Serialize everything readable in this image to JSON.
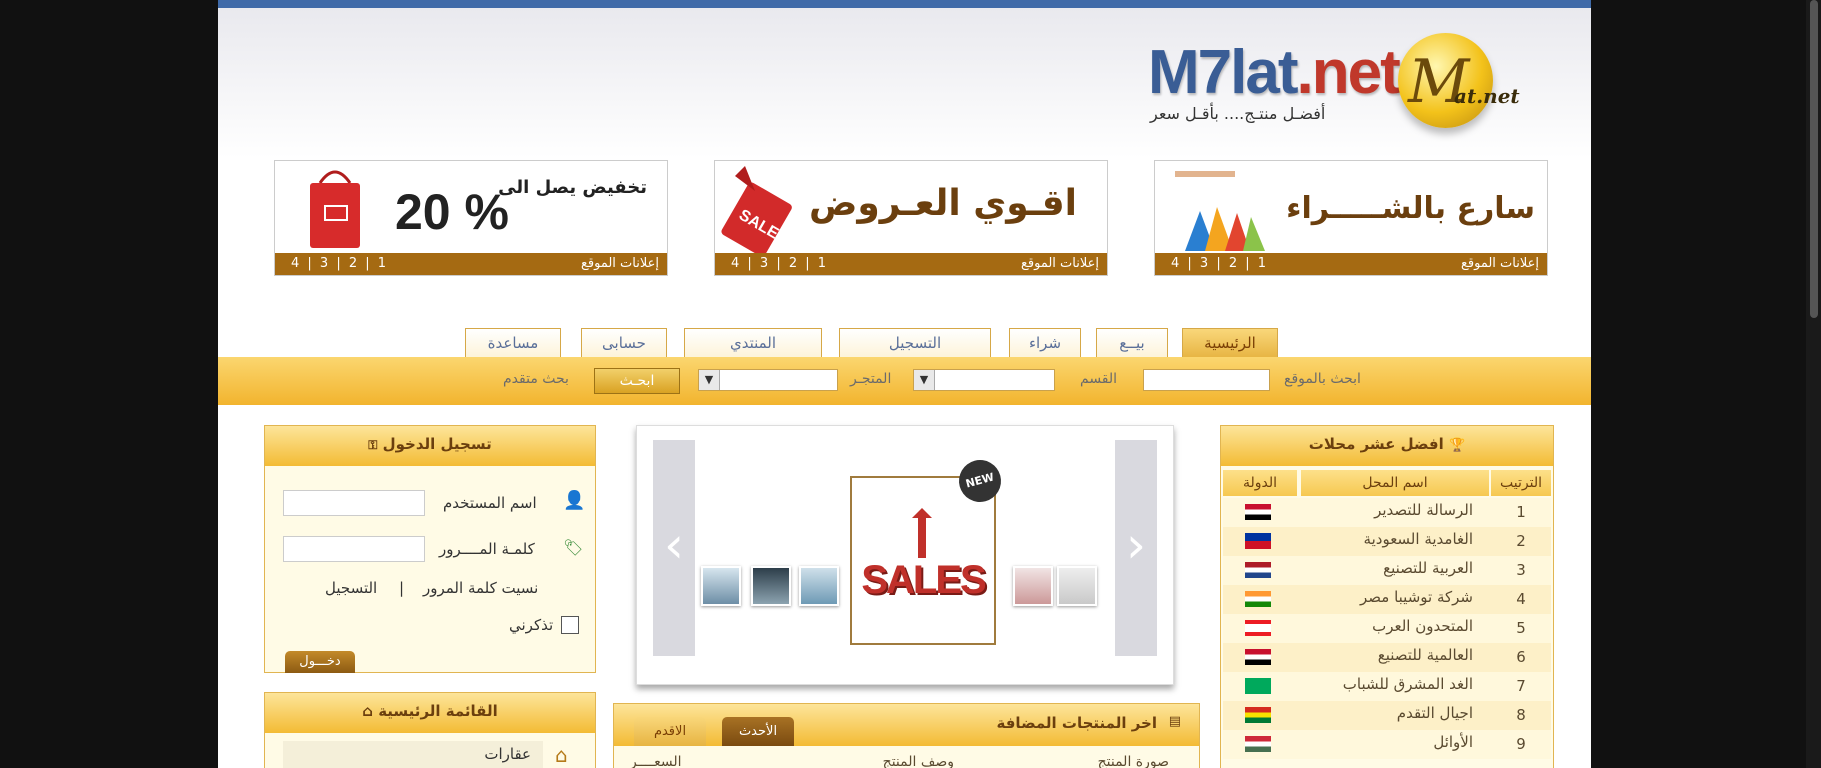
{
  "header": {
    "brand_main": "M7lat",
    "brand_dot": ".net",
    "slogan": "أفضـل منتـج.... بأقـل سعر",
    "logo_text": "at.net",
    "logo_letter": "M"
  },
  "banners": [
    {
      "headline": "سارع بالشـــــراء",
      "label": "إعلانات الموقع",
      "nums": "4 | 3 | 2 | 1"
    },
    {
      "headline": "اقـوي العـروض",
      "label": "إعلانات الموقع",
      "nums": "4 | 3 | 2 | 1"
    },
    {
      "headline": "تخفيض يصل الى",
      "headline2": "20 %",
      "label": "إعلانات الموقع",
      "nums": "4 | 3 | 2 | 1"
    }
  ],
  "nav": {
    "tabs": [
      "الرئيسية",
      "بيــع",
      "شراء",
      "التسجيل",
      "المنتدي",
      "حسابى",
      "مساعدة"
    ],
    "active_tab": "الرئيسية"
  },
  "search": {
    "site_search_label": "ابحث بالموقع",
    "section_label": "القسم",
    "store_label": "المتجـر",
    "search_button": "ابحـث",
    "advanced_label": "بحث متقدم"
  },
  "login": {
    "title": "تسجيل الدخول",
    "username_label": "اسم المستخدم",
    "password_label": "كلمـة المــــرور",
    "forgot_label": "نسيت كلمة المرور",
    "separator": "|",
    "register_label": "التسجيل",
    "remember_label": "تذكرني",
    "login_button": "دخـــول"
  },
  "main_menu": {
    "title": "القائمة الرئيسية",
    "items": [
      "عقارات"
    ]
  },
  "slider": {
    "sales_text": "SALES",
    "new_badge": "NEW"
  },
  "products": {
    "title": "اخر المنتجات المضافة",
    "tab_newest": "الأحدث",
    "tab_oldest": "الاقدم",
    "col_image": "صورة المنتج",
    "col_desc": "وصف المنتج",
    "col_price": "السعــــر"
  },
  "top_stores": {
    "title": "افضل عشر محلات",
    "col_rank": "الترتيب",
    "col_name": "اسم المحل",
    "col_country": "الدولة",
    "rows": [
      {
        "rank": "1",
        "name": "الرسالة للتصدير",
        "flag": "egypt"
      },
      {
        "rank": "2",
        "name": "الغامدية السعودية",
        "flag": "liechtenstein"
      },
      {
        "rank": "3",
        "name": "العربية للتصنيع",
        "flag": "netherlands"
      },
      {
        "rank": "4",
        "name": "شركة توشيبا مصر",
        "flag": "india"
      },
      {
        "rank": "5",
        "name": "المتحدون العرب",
        "flag": "lebanon"
      },
      {
        "rank": "6",
        "name": "العالمية للتصنيع",
        "flag": "egypt"
      },
      {
        "rank": "7",
        "name": "الغد المشرق للشباب",
        "flag": "mauritania"
      },
      {
        "rank": "8",
        "name": "اجيال التقدم",
        "flag": "bolivia"
      },
      {
        "rank": "9",
        "name": "الأوائل",
        "flag": "hungary"
      }
    ]
  },
  "colors": {
    "top_bar": "#3f6aa8",
    "accent_gold": "#f3bb34",
    "banner_bar": "#a56a12"
  }
}
